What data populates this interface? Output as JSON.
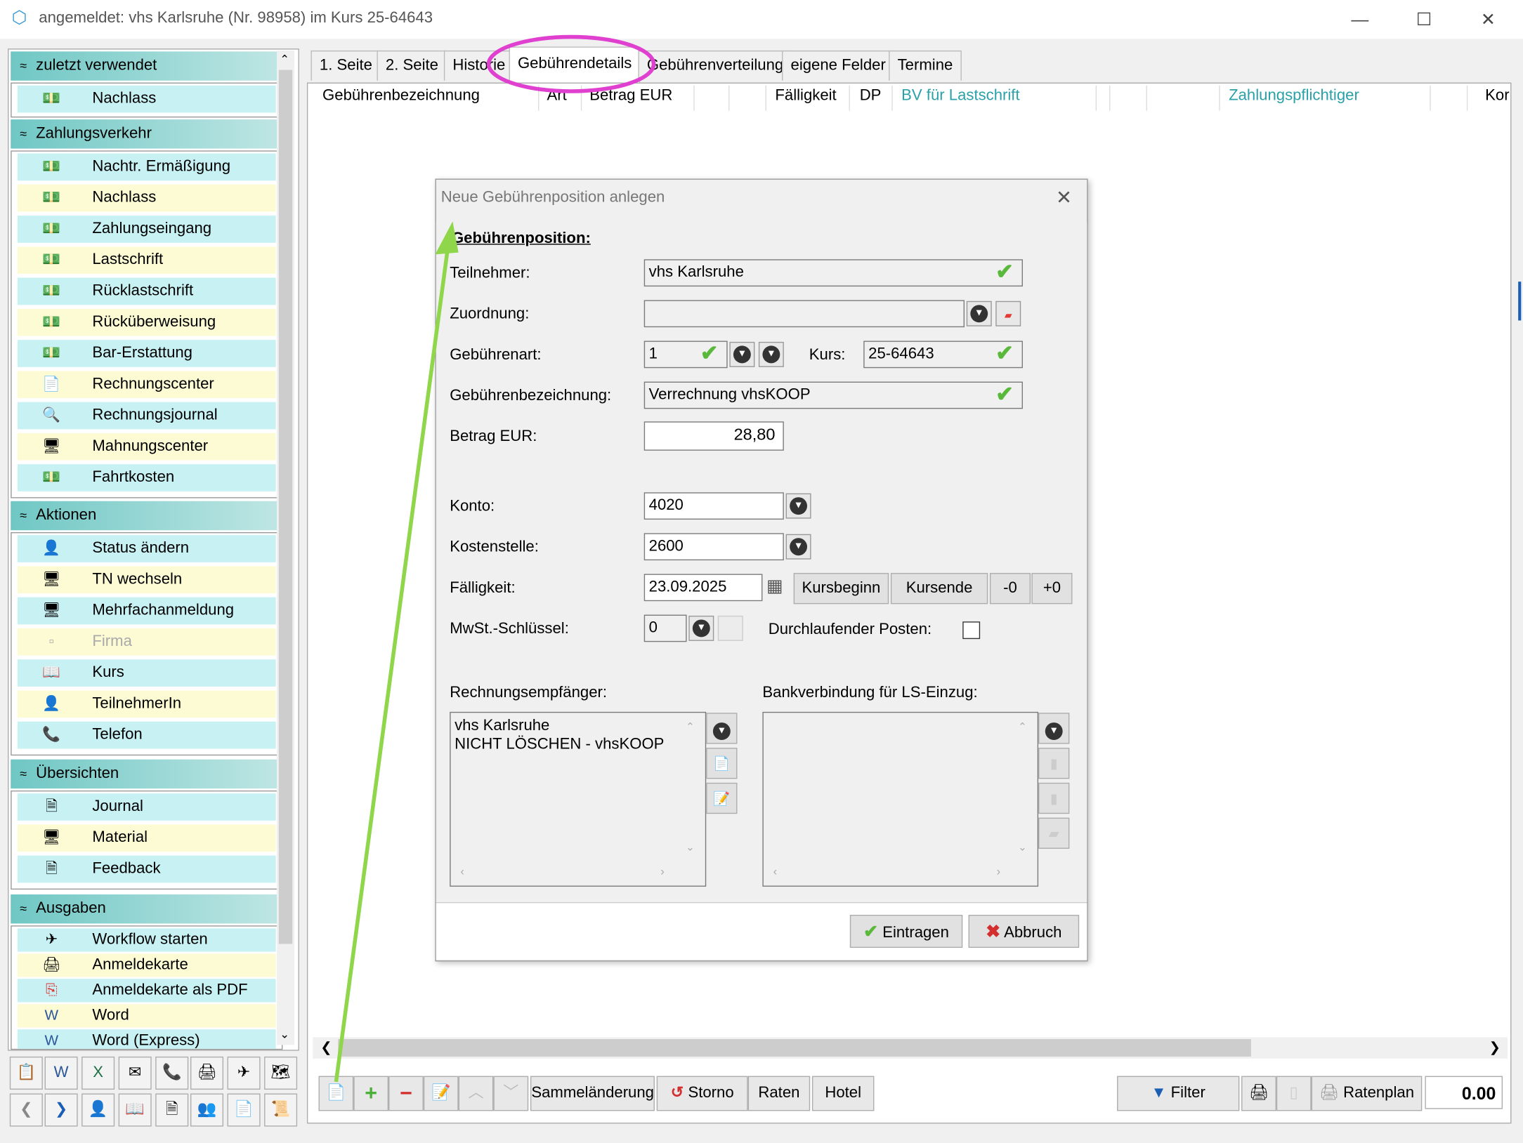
{
  "window": {
    "title": "angemeldet: vhs Karlsruhe (Nr. 98958) im Kurs 25-64643",
    "minimize": "—",
    "maximize": "☐",
    "close": "✕"
  },
  "sidebar": {
    "sections": [
      {
        "title": "zuletzt verwendet",
        "items": [
          {
            "label": "Nachlass",
            "icon": "money-icon"
          }
        ]
      },
      {
        "title": "Zahlungsverkehr",
        "items": [
          {
            "label": "Nachtr. Ermäßigung"
          },
          {
            "label": "Nachlass"
          },
          {
            "label": "Zahlungseingang"
          },
          {
            "label": "Lastschrift"
          },
          {
            "label": "Rücklastschrift"
          },
          {
            "label": "Rücküberweisung"
          },
          {
            "label": "Bar-Erstattung"
          },
          {
            "label": "Rechnungscenter"
          },
          {
            "label": "Rechnungsjournal"
          },
          {
            "label": "Mahnungscenter"
          },
          {
            "label": "Fahrtkosten"
          }
        ]
      },
      {
        "title": "Aktionen",
        "items": [
          {
            "label": "Status ändern"
          },
          {
            "label": "TN wechseln"
          },
          {
            "label": "Mehrfachanmeldung"
          },
          {
            "label": "Firma"
          },
          {
            "label": "Kurs"
          },
          {
            "label": "TeilnehmerIn"
          },
          {
            "label": "Telefon"
          }
        ]
      },
      {
        "title": "Übersichten",
        "items": [
          {
            "label": "Journal"
          },
          {
            "label": "Material"
          },
          {
            "label": "Feedback"
          }
        ]
      },
      {
        "title": "Ausgaben",
        "items": [
          {
            "label": "Workflow starten"
          },
          {
            "label": "Anmeldekarte"
          },
          {
            "label": "Anmeldekarte als PDF"
          },
          {
            "label": "Word"
          },
          {
            "label": "Word (Express)"
          }
        ]
      }
    ]
  },
  "tabs": [
    "1. Seite",
    "2. Seite",
    "Historie",
    "Gebührendetails",
    "Gebührenverteilung",
    "eigene Felder",
    "Termine"
  ],
  "columns": [
    "Gebührenbezeichnung",
    "Art",
    "Betrag EUR",
    "Fälligkeit",
    "DP",
    "BV für Lastschrift",
    "Zahlungspflichtiger",
    "Kor"
  ],
  "dialog": {
    "title": "Neue Gebührenposition anlegen",
    "section": "Gebührenposition:",
    "labels": {
      "teilnehmer": "Teilnehmer:",
      "zuordnung": "Zuordnung:",
      "gebuehrenart": "Gebührenart:",
      "kurs": "Kurs:",
      "bezeichnung": "Gebührenbezeichnung:",
      "betrag": "Betrag EUR:",
      "konto": "Konto:",
      "kostenstelle": "Kostenstelle:",
      "faelligkeit": "Fälligkeit:",
      "mwst": "MwSt.-Schlüssel:",
      "durchlaufend": "Durchlaufender Posten:",
      "rechnungsempfaenger": "Rechnungsempfänger:",
      "bankverbindung": "Bankverbindung für LS-Einzug:"
    },
    "values": {
      "teilnehmer": "vhs Karlsruhe",
      "zuordnung": "",
      "gebuehrenart": "1",
      "kurs": "25-64643",
      "bezeichnung": "Verrechnung vhsKOOP",
      "betrag": "28,80",
      "konto": "4020",
      "kostenstelle": "2600",
      "faelligkeit": "23.09.2025",
      "mwst": "0",
      "rechnungsempfaenger_line1": "vhs Karlsruhe",
      "rechnungsempfaenger_line2": "NICHT LÖSCHEN - vhsKOOP"
    },
    "buttons": {
      "kursbeginn": "Kursbeginn",
      "kursende": "Kursende",
      "minus": "-0",
      "plus": "+0",
      "eintragen": "Eintragen",
      "abbruch": "Abbruch"
    }
  },
  "main_toolbar": {
    "sammelaenderung": "Sammeländerung",
    "storno": "Storno",
    "raten": "Raten",
    "hotel": "Hotel",
    "filter": "Filter",
    "ratenplan": "Ratenplan",
    "total": "0.00"
  },
  "colors": {
    "accent_teal": "#6fc7c4",
    "row_cyan": "#c8f1f4",
    "row_yellow": "#fdfbd4",
    "annotation_magenta": "#e040d0",
    "annotation_green": "#8fd64b",
    "link_teal": "#2aa0a8"
  }
}
